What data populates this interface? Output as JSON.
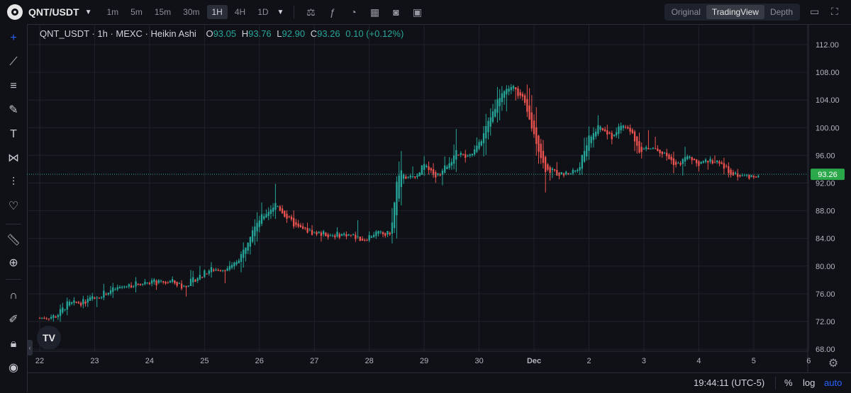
{
  "header": {
    "symbol": "QNT/USDT",
    "timeframes": [
      "1m",
      "5m",
      "15m",
      "30m",
      "1H",
      "4H",
      "1D"
    ],
    "active_timeframe": "1H",
    "tool_icons": [
      "indicator-compare-icon",
      "fx-icon",
      "dashboard-icon",
      "layout-icon",
      "camera-icon",
      "save-icon"
    ],
    "views": [
      "Original",
      "TradingView",
      "Depth"
    ],
    "active_view": "TradingView"
  },
  "legend": {
    "name": "QNT_USDT · 1h · MEXC · Heikin Ashi",
    "o_key": "O",
    "o_val": "93.05",
    "h_key": "H",
    "h_val": "93.76",
    "l_key": "L",
    "l_val": "92.90",
    "c_key": "C",
    "c_val": "93.26",
    "change": "0.10 (+0.12%)"
  },
  "badge": {
    "tv_logo": "TV"
  },
  "bottom": {
    "clock": "19:44:11 (UTC-5)",
    "pct": "%",
    "log": "log",
    "auto": "auto"
  },
  "colors": {
    "up": "#26a69a",
    "down": "#ef5350",
    "last_price_bg": "#2ba84a",
    "bg": "#0f1116",
    "grid": "#1f232b"
  },
  "chart_data": {
    "type": "candlestick",
    "style": "Heikin Ashi",
    "interval": "1h",
    "exchange": "MEXC",
    "xlabel": "",
    "ylabel": "",
    "ylim": [
      68,
      112
    ],
    "y_ticks": [
      "112.00",
      "108.00",
      "104.00",
      "100.00",
      "96.00",
      "92.00",
      "88.00",
      "84.00",
      "80.00",
      "76.00",
      "72.00",
      "68.00"
    ],
    "x_ticks": [
      {
        "label": "22",
        "day": 0
      },
      {
        "label": "23",
        "day": 1
      },
      {
        "label": "24",
        "day": 2
      },
      {
        "label": "25",
        "day": 3
      },
      {
        "label": "26",
        "day": 4
      },
      {
        "label": "27",
        "day": 5
      },
      {
        "label": "28",
        "day": 6
      },
      {
        "label": "29",
        "day": 7
      },
      {
        "label": "30",
        "day": 8
      },
      {
        "label": "Dec",
        "day": 9
      },
      {
        "label": "2",
        "day": 10
      },
      {
        "label": "3",
        "day": 11
      },
      {
        "label": "4",
        "day": 12
      },
      {
        "label": "5",
        "day": 13
      },
      {
        "label": "6",
        "day": 14
      }
    ],
    "x_range_days": [
      -0.1,
      14.1
    ],
    "last_price": "93.26",
    "last_price_value": 93.26,
    "price_path": [
      [
        0.0,
        72.5
      ],
      [
        0.3,
        72.8
      ],
      [
        0.5,
        74.5
      ],
      [
        0.8,
        74.8
      ],
      [
        1.0,
        75.5
      ],
      [
        1.3,
        76.5
      ],
      [
        1.6,
        77.2
      ],
      [
        2.0,
        77.8
      ],
      [
        2.2,
        77.5
      ],
      [
        2.4,
        77.8
      ],
      [
        2.6,
        77.0
      ],
      [
        2.9,
        78.5
      ],
      [
        3.1,
        79.5
      ],
      [
        3.3,
        79.6
      ],
      [
        3.5,
        79.8
      ],
      [
        3.7,
        82.0
      ],
      [
        3.9,
        86.0
      ],
      [
        4.1,
        87.5
      ],
      [
        4.3,
        89.0
      ],
      [
        4.5,
        87.0
      ],
      [
        4.7,
        85.5
      ],
      [
        5.0,
        84.8
      ],
      [
        5.3,
        84.5
      ],
      [
        5.6,
        84.6
      ],
      [
        5.9,
        83.8
      ],
      [
        6.1,
        84.8
      ],
      [
        6.3,
        84.5
      ],
      [
        6.4,
        85.0
      ],
      [
        6.5,
        92.0
      ],
      [
        6.6,
        93.8
      ],
      [
        6.7,
        92.5
      ],
      [
        6.9,
        93.5
      ],
      [
        7.0,
        95.0
      ],
      [
        7.2,
        92.5
      ],
      [
        7.4,
        94.5
      ],
      [
        7.6,
        96.5
      ],
      [
        7.8,
        95.5
      ],
      [
        8.0,
        97.5
      ],
      [
        8.2,
        101.5
      ],
      [
        8.4,
        105.0
      ],
      [
        8.6,
        106.0
      ],
      [
        8.8,
        104.0
      ],
      [
        9.0,
        99.0
      ],
      [
        9.2,
        94.0
      ],
      [
        9.5,
        93.2
      ],
      [
        9.8,
        94.0
      ],
      [
        10.0,
        98.5
      ],
      [
        10.2,
        100.2
      ],
      [
        10.4,
        98.5
      ],
      [
        10.6,
        100.5
      ],
      [
        10.8,
        99.0
      ],
      [
        10.9,
        96.8
      ],
      [
        11.2,
        97.0
      ],
      [
        11.4,
        96.0
      ],
      [
        11.6,
        94.5
      ],
      [
        11.8,
        95.8
      ],
      [
        12.0,
        94.5
      ],
      [
        12.2,
        95.5
      ],
      [
        12.4,
        94.5
      ],
      [
        12.6,
        93.5
      ],
      [
        12.8,
        93.0
      ],
      [
        13.0,
        93.0
      ],
      [
        13.1,
        93.26
      ]
    ],
    "candles_per_day": 24,
    "last_candle": {
      "o": 93.05,
      "h": 93.76,
      "l": 92.9,
      "c": 93.26
    }
  }
}
